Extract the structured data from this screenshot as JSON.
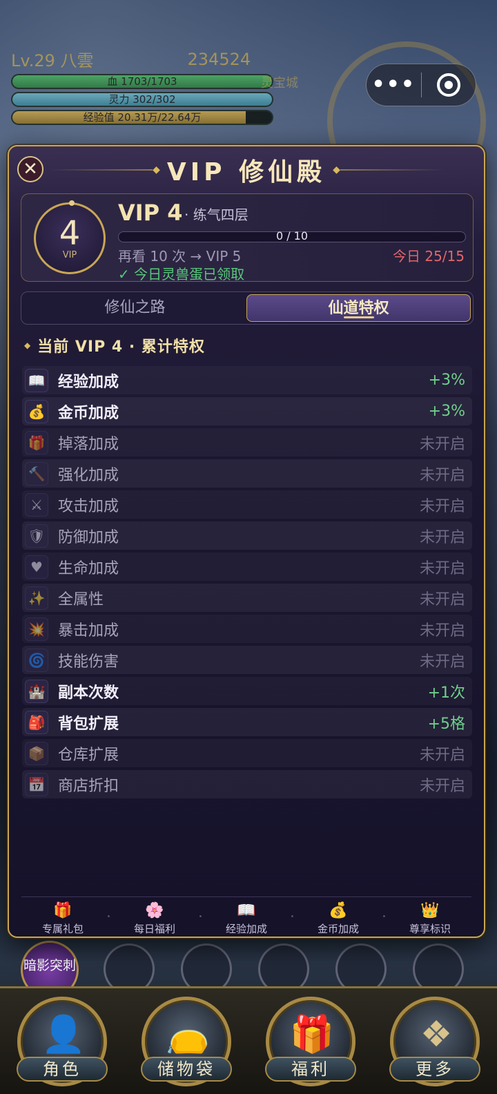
{
  "hud": {
    "level_name": "Lv.29 八雲",
    "gold": "234524",
    "hp": "血 1703/1703",
    "mp": "灵力 302/302",
    "xp": "经验值 20.31万/22.64万",
    "mall": "灵宝城"
  },
  "capsule": {
    "more": "•••"
  },
  "skill": {
    "label": "暗影突刺"
  },
  "modal": {
    "close": "✕",
    "title": "VIP 修仙殿",
    "vip_number": "4",
    "vip_small": "VIP",
    "vip_level": "VIP 4",
    "realm": "· 练气四层",
    "progress_text": "0 / 10",
    "progress_fraction": 0.0,
    "next_hint": "再看 10 次 → VIP 5",
    "today": "今日 25/15",
    "claimed": "✓ 今日灵兽蛋已领取",
    "tabs": [
      "修仙之路",
      "仙道特权"
    ],
    "section": "当前 VIP 4 · 累计特权",
    "privileges": [
      {
        "icon": "📖",
        "name": "经验加成",
        "value": "+3%",
        "on": true
      },
      {
        "icon": "💰",
        "name": "金币加成",
        "value": "+3%",
        "on": true
      },
      {
        "icon": "🎁",
        "name": "掉落加成",
        "value": "未开启",
        "on": false
      },
      {
        "icon": "🔨",
        "name": "强化加成",
        "value": "未开启",
        "on": false
      },
      {
        "icon": "⚔",
        "name": "攻击加成",
        "value": "未开启",
        "on": false
      },
      {
        "icon": "🛡",
        "name": "防御加成",
        "value": "未开启",
        "on": false
      },
      {
        "icon": "♥",
        "name": "生命加成",
        "value": "未开启",
        "on": false
      },
      {
        "icon": "✨",
        "name": "全属性",
        "value": "未开启",
        "on": false
      },
      {
        "icon": "💥",
        "name": "暴击加成",
        "value": "未开启",
        "on": false
      },
      {
        "icon": "🌀",
        "name": "技能伤害",
        "value": "未开启",
        "on": false
      },
      {
        "icon": "🏰",
        "name": "副本次数",
        "value": "+1次",
        "on": true
      },
      {
        "icon": "🎒",
        "name": "背包扩展",
        "value": "+5格",
        "on": true
      },
      {
        "icon": "📦",
        "name": "仓库扩展",
        "value": "未开启",
        "on": false
      },
      {
        "icon": "📅",
        "name": "商店折扣",
        "value": "未开启",
        "on": false
      }
    ],
    "footer": [
      {
        "icon": "🎁",
        "label": "专属礼包"
      },
      {
        "icon": "🌸",
        "label": "每日福利"
      },
      {
        "icon": "📖",
        "label": "经验加成"
      },
      {
        "icon": "💰",
        "label": "金币加成"
      },
      {
        "icon": "👑",
        "label": "尊享标识"
      }
    ]
  },
  "bottom_nav": [
    {
      "label": "角色",
      "icon": "👤"
    },
    {
      "label": "储物袋",
      "icon": "👝"
    },
    {
      "label": "福利",
      "icon": "🎁"
    },
    {
      "label": "更多",
      "icon": "❖"
    }
  ]
}
